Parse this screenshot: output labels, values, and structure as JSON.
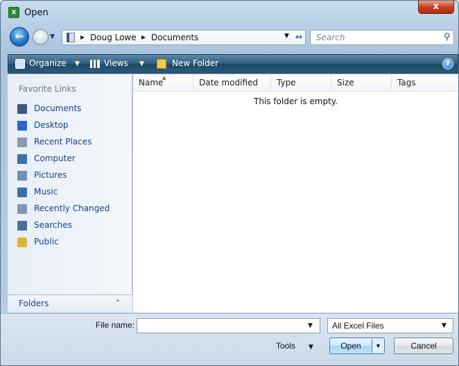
{
  "window": {
    "title": "Open",
    "close_symbol": "x"
  },
  "address": {
    "crumbs": [
      "Doug Lowe",
      "Documents"
    ],
    "search_placeholder": "Search"
  },
  "toolbar": {
    "organize_label": "Organize",
    "views_label": "Views",
    "new_folder_label": "New Folder",
    "help_symbol": "?"
  },
  "nav": {
    "header": "Favorite Links",
    "items": [
      {
        "label": "Documents",
        "icon": "documents-icon",
        "color": "#3d5a80"
      },
      {
        "label": "Desktop",
        "icon": "desktop-icon",
        "color": "#2a66c9"
      },
      {
        "label": "Recent Places",
        "icon": "recent-places-icon",
        "color": "#8a9bb0"
      },
      {
        "label": "Computer",
        "icon": "computer-icon",
        "color": "#3a6fb0"
      },
      {
        "label": "Pictures",
        "icon": "pictures-icon",
        "color": "#6f8fb4"
      },
      {
        "label": "Music",
        "icon": "music-icon",
        "color": "#3d6ea8"
      },
      {
        "label": "Recently Changed",
        "icon": "recently-changed-icon",
        "color": "#7e96b3"
      },
      {
        "label": "Searches",
        "icon": "searches-icon",
        "color": "#4a6e9a"
      },
      {
        "label": "Public",
        "icon": "public-icon",
        "color": "#e0b53a"
      }
    ],
    "folders_label": "Folders"
  },
  "content": {
    "columns": [
      "Name",
      "Date modified",
      "Type",
      "Size",
      "Tags"
    ],
    "empty_message": "This folder is empty."
  },
  "bottom": {
    "file_name_label": "File name:",
    "file_name_value": "",
    "file_type_value": "All Excel Files",
    "tools_label": "Tools",
    "open_label": "Open",
    "cancel_label": "Cancel"
  }
}
